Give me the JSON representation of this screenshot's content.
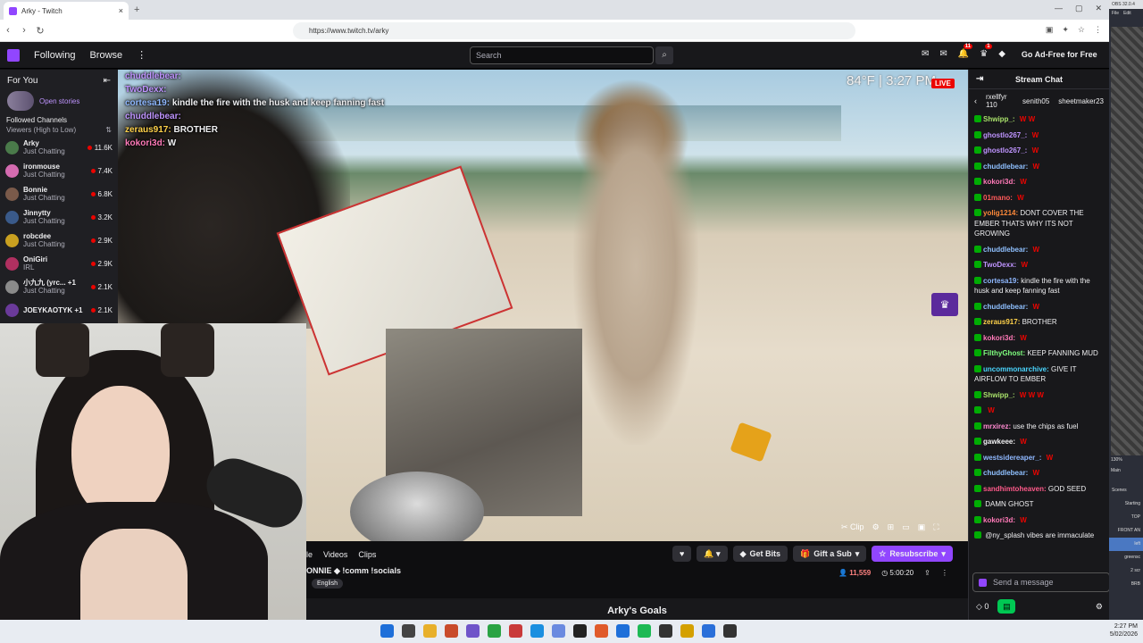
{
  "browser": {
    "tab_title": "Arky - Twitch",
    "new_tab": "+",
    "close": "×",
    "url": "https://www.twitch.tv/arky",
    "win_min": "—",
    "win_max": "▢",
    "win_close": "✕"
  },
  "twitch_nav": {
    "following": "Following",
    "browse": "Browse",
    "more": "⋮",
    "search_placeholder": "Search",
    "notif_count": "11",
    "notif2_count": "1",
    "ad_free": "Go Ad-Free for Free"
  },
  "sidebar": {
    "for_you": "For You",
    "collapse": "⇤",
    "open_stories": "Open stories",
    "followed_channels": "Followed Channels",
    "sort": "Viewers (High to Low)",
    "channels": [
      {
        "name": "Arky",
        "game": "Just Chatting",
        "viewers": "11.6K",
        "color": "#4a7a4a"
      },
      {
        "name": "ironmouse",
        "game": "Just Chatting",
        "viewers": "7.4K",
        "color": "#d46bb0"
      },
      {
        "name": "Bonnie",
        "game": "Just Chatting",
        "viewers": "6.8K",
        "color": "#7a5a4a"
      },
      {
        "name": "Jinnytty",
        "game": "Just Chatting",
        "viewers": "3.2K",
        "color": "#3a5a8a"
      },
      {
        "name": "robcdee",
        "game": "Just Chatting",
        "viewers": "2.9K",
        "color": "#c9a020"
      },
      {
        "name": "OniGiri",
        "game": "IRL",
        "viewers": "2.9K",
        "color": "#b03060"
      },
      {
        "name": "小九九 (yrc... +1",
        "game": "Just Chatting",
        "viewers": "2.1K",
        "color": "#8a8a8a"
      },
      {
        "name": "JOEYKAOTYK +1",
        "game": "",
        "viewers": "2.1K",
        "color": "#6a3a9a"
      }
    ]
  },
  "video": {
    "overlay_chat": [
      {
        "user": "chuddlebear:",
        "text": "",
        "color": "#bf94ff"
      },
      {
        "user": "TwoDexx:",
        "text": "",
        "color": "#bf94ff"
      },
      {
        "user": "cortesa19:",
        "text": "kindle the fire with the husk and keep fanning fast",
        "color": "#8fb8ff"
      },
      {
        "user": "chuddlebear:",
        "text": "",
        "color": "#bf94ff"
      },
      {
        "user": "zeraus917:",
        "text": "BROTHER",
        "color": "#ffd24a"
      },
      {
        "user": "kokori3d:",
        "text": "W",
        "color": "#ff7ab8"
      }
    ],
    "temp": "84°F | 3:27 PM",
    "live": "LIVE",
    "clip": "Clip"
  },
  "info": {
    "tabs": [
      "le",
      "Videos",
      "Clips"
    ],
    "title": "ONNIE ◆ !comm !socials",
    "language": "English",
    "actions": {
      "heart": "♥",
      "bell": "🔔",
      "get_bits": "Get Bits",
      "gift_sub": "Gift a Sub",
      "resubscribe": "Resubscribe"
    },
    "viewers": "11,559",
    "uptime": "5:00:20",
    "goals": "Arky's Goals"
  },
  "chat": {
    "header": "Stream Chat",
    "gifters": [
      {
        "name": "rxellfyr",
        "count": "110"
      },
      {
        "name": "senith05",
        "count": ""
      },
      {
        "name": "sheetmaker23",
        "count": ""
      }
    ],
    "messages": [
      {
        "user": "Shwipp_:",
        "text": "",
        "w": "W W",
        "color": "#a8e06a"
      },
      {
        "user": "ghostlo267_:",
        "text": "",
        "w": "W",
        "color": "#bf94ff"
      },
      {
        "user": "ghostlo267_:",
        "text": "",
        "w": "W",
        "color": "#bf94ff"
      },
      {
        "user": "chuddlebear:",
        "text": "",
        "w": "W",
        "color": "#8fc0ff"
      },
      {
        "user": "kokori3d:",
        "text": "",
        "w": "W",
        "color": "#ff7ab8"
      },
      {
        "user": "01mano:",
        "text": "",
        "w": "W",
        "color": "#ff5a5a"
      },
      {
        "user": "yolig1214:",
        "text": "DONT COVER THE EMBER THATS WHY ITS NOT GROWING",
        "w": "",
        "color": "#ff8a3a"
      },
      {
        "user": "chuddlebear:",
        "text": "",
        "w": "W",
        "color": "#8fc0ff"
      },
      {
        "user": "TwoDexx:",
        "text": "",
        "w": "W",
        "color": "#bf94ff"
      },
      {
        "user": "cortesa19:",
        "text": "kindle the fire with the husk and keep fanning fast",
        "w": "",
        "color": "#8fb8ff"
      },
      {
        "user": "chuddlebear:",
        "text": "",
        "w": "W",
        "color": "#8fc0ff"
      },
      {
        "user": "zeraus917:",
        "text": "BROTHER",
        "w": "",
        "color": "#ffd24a"
      },
      {
        "user": "kokori3d:",
        "text": "",
        "w": "W",
        "color": "#ff7ab8"
      },
      {
        "user": "FilthyGhost:",
        "text": "KEEP FANNING MUD",
        "w": "",
        "color": "#7fff7f"
      },
      {
        "user": "uncommonarchive:",
        "text": "GIVE IT AIRFLOW TO EMBER",
        "w": "",
        "color": "#4ad6ff"
      },
      {
        "user": "Shwipp_:",
        "text": "",
        "w": "W W W",
        "color": "#a8e06a"
      },
      {
        "user": "",
        "text": "",
        "w": "W",
        "color": "#bf94ff"
      },
      {
        "user": "mrxirez:",
        "text": "use the chips as fuel",
        "w": "",
        "color": "#ff8ad0"
      },
      {
        "user": "gawkeee:",
        "text": "",
        "w": "W",
        "color": "#efeff1"
      },
      {
        "user": "westsidereaper_:",
        "text": "",
        "w": "W",
        "color": "#8fb8ff"
      },
      {
        "user": "chuddlebear:",
        "text": "",
        "w": "W",
        "color": "#8fc0ff"
      },
      {
        "user": "sandhimtoheaven:",
        "text": "GOD SEED",
        "w": "",
        "color": "#ff5a8a"
      },
      {
        "user": "",
        "text": "DAMN GHOST",
        "w": "",
        "color": "#efeff1"
      },
      {
        "user": "kokori3d:",
        "text": "",
        "w": "W",
        "color": "#ff7ab8"
      },
      {
        "user": "",
        "text": "@ny_splash vibes are immaculate",
        "w": "",
        "color": "#bf94ff"
      }
    ],
    "send_placeholder": "Send a message",
    "points": "0"
  },
  "obs": {
    "title": "OBS 32.0.4",
    "menu_file": "File",
    "menu_edit": "Edit",
    "zoom": "130%",
    "main": "Main",
    "scenes_title": "Scenes",
    "scenes": [
      "Starting",
      "TOP",
      "FRONT AN",
      "left",
      "greensc",
      "2 scr",
      "BRB"
    ],
    "active_scene": 3
  },
  "taskbar": {
    "time": "2:27 PM",
    "date": "5/02/2026",
    "icon_colors": [
      "#1e6fd9",
      "#444",
      "#e8b02a",
      "#c94b2b",
      "#6f54c9",
      "#2aa344",
      "#c93a3a",
      "#1a8fe0",
      "#6a8ae0",
      "#222",
      "#e05a2a",
      "#1e6fd9",
      "#1db954",
      "#333",
      "#d4a000",
      "#2a6fd9",
      "#333"
    ]
  }
}
